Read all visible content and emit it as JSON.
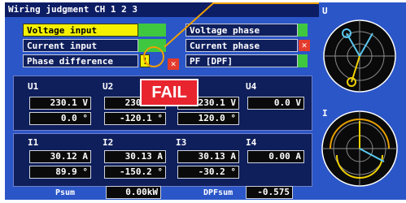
{
  "title": "Wiring judgment  CH 1 2 3",
  "rows_left": [
    {
      "label": "Voltage input"
    },
    {
      "label": "Current input"
    },
    {
      "label": "Phase difference"
    }
  ],
  "rows_right": [
    {
      "label": "Voltage phase"
    },
    {
      "label": "Current phase"
    },
    {
      "label": "PF [DPF]"
    }
  ],
  "phase_indicator": "!",
  "fail_mark": "✕",
  "fail_label": "FAIL",
  "voltage": {
    "channels": [
      {
        "ch": "U1",
        "value": "230.1 V",
        "angle": "0.0 °"
      },
      {
        "ch": "U2",
        "value": "230.1 V",
        "angle": "-120.1 °"
      },
      {
        "ch": "U3",
        "value": "230.1 V",
        "angle": "120.0 °"
      },
      {
        "ch": "U4",
        "value": "0.0 V",
        "angle": ""
      }
    ]
  },
  "current": {
    "channels": [
      {
        "ch": "I1",
        "value": "30.12 A",
        "angle": "89.9 °"
      },
      {
        "ch": "I2",
        "value": "30.13 A",
        "angle": "-150.2 °"
      },
      {
        "ch": "I3",
        "value": "30.13 A",
        "angle": "-30.2 °"
      },
      {
        "ch": "I4",
        "value": "0.00 A",
        "angle": ""
      }
    ]
  },
  "footer": {
    "psum_label": "Psum",
    "psum_value": "0.00kW",
    "dpf_label": "DPFsum",
    "dpf_value": "-0.575"
  },
  "side": {
    "u_label": "U",
    "i_label": "I"
  },
  "colors": {
    "screen": "#2b56c8",
    "highlight": "#f4f000",
    "ok": "#3fc83f",
    "fail": "#e8252f",
    "marker": "#f0a000"
  }
}
